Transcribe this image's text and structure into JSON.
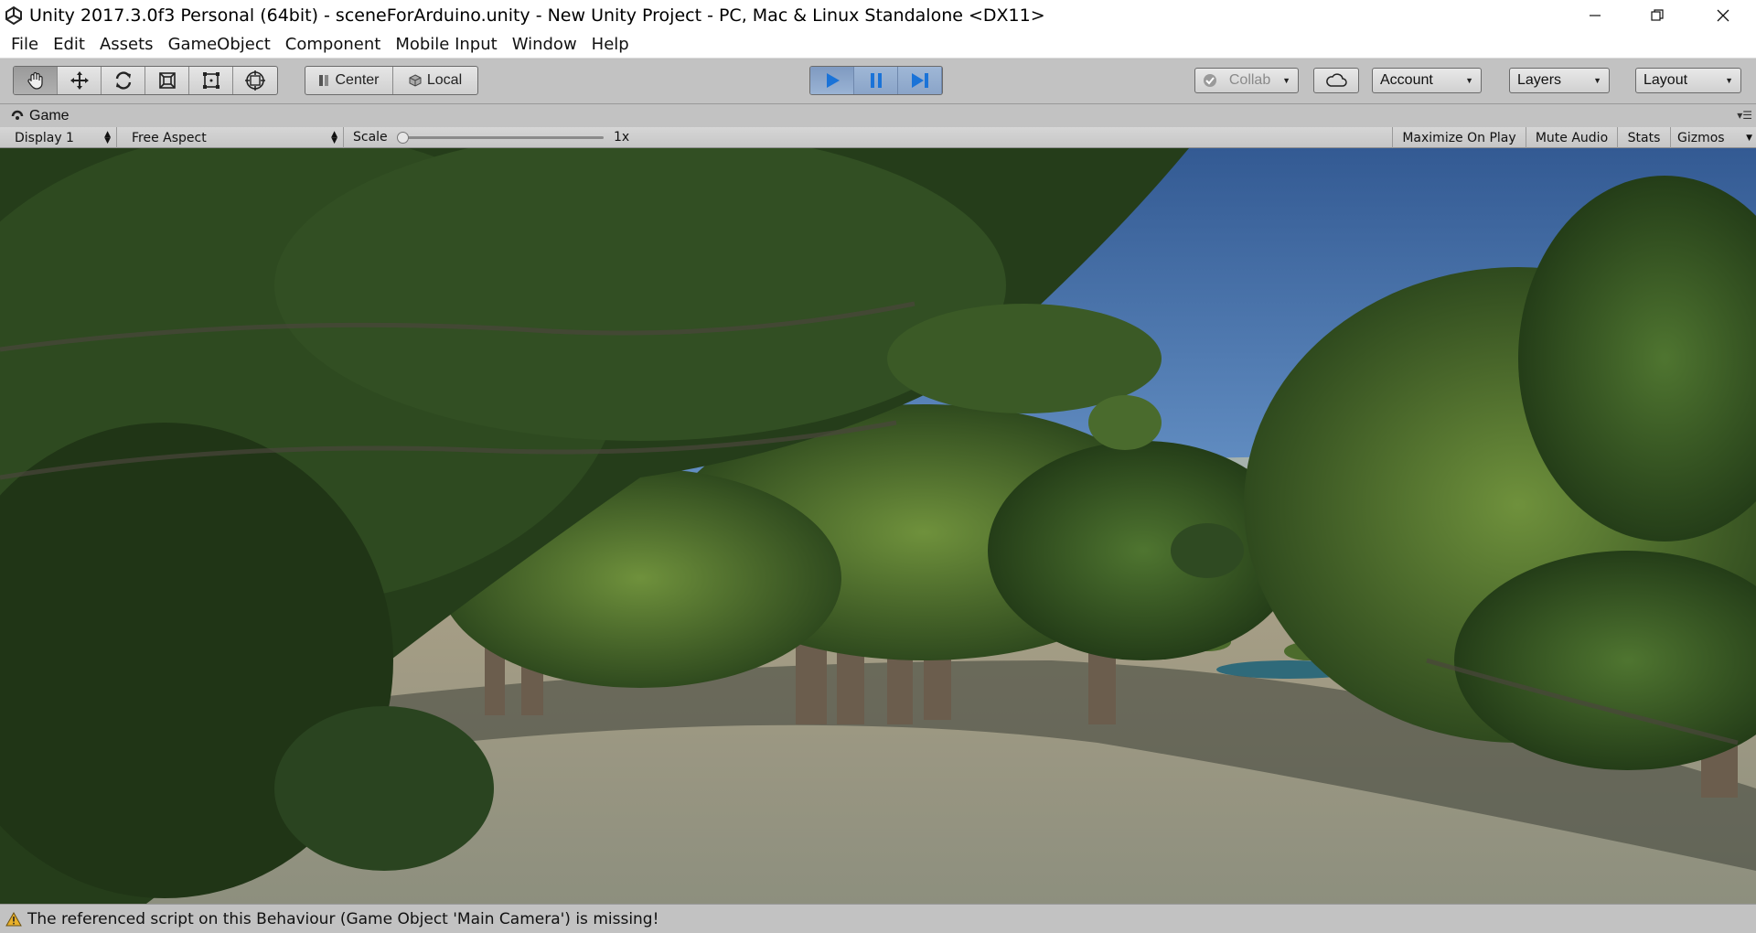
{
  "window": {
    "title": "Unity 2017.3.0f3 Personal (64bit) - sceneForArduino.unity - New Unity Project - PC, Mac & Linux Standalone <DX11>",
    "icon": "unity-logo-icon"
  },
  "menu": [
    "File",
    "Edit",
    "Assets",
    "GameObject",
    "Component",
    "Mobile Input",
    "Window",
    "Help"
  ],
  "toolbar": {
    "tools": [
      "hand-icon",
      "move-icon",
      "rotate-icon",
      "scale-icon",
      "rect-icon",
      "transform-icon"
    ],
    "pivot_center": "Center",
    "pivot_local": "Local",
    "collab": "Collab",
    "account": "Account",
    "layers": "Layers",
    "layout": "Layout"
  },
  "tab": {
    "label": "Game"
  },
  "gamebar": {
    "display": "Display 1",
    "aspect": "Free Aspect",
    "scale_label": "Scale",
    "scale_value": "1x",
    "maximize": "Maximize On Play",
    "mute": "Mute Audio",
    "stats": "Stats",
    "gizmos": "Gizmos"
  },
  "status": {
    "message": "The referenced script on this Behaviour (Game Object 'Main Camera') is missing!",
    "icon": "warning-icon"
  },
  "colors": {
    "sky": "#3f6aa6",
    "foliage": "#2f4a22",
    "ground": "#9a9a84",
    "play_accent": "#1a73d8"
  }
}
